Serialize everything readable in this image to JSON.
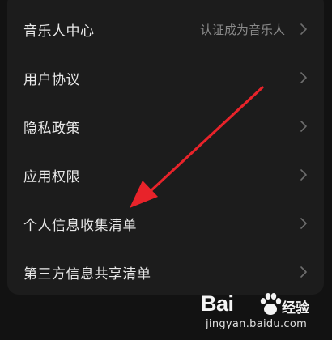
{
  "settings_list": {
    "items": [
      {
        "label": "音乐人中心",
        "value": "认证成为音乐人"
      },
      {
        "label": "用户协议",
        "value": ""
      },
      {
        "label": "隐私政策",
        "value": ""
      },
      {
        "label": "应用权限",
        "value": ""
      },
      {
        "label": "个人信息收集清单",
        "value": ""
      },
      {
        "label": "第三方信息共享清单",
        "value": ""
      }
    ]
  },
  "annotation": {
    "arrow_color": "#e8232a"
  },
  "watermark": {
    "logo_text": "Bai",
    "suffix": "经验",
    "url": "jingyan.baidu.com"
  },
  "colors": {
    "background": "#121212",
    "card": "#1c1c1c",
    "label": "#e8e8e8",
    "secondary": "#8a8a8a"
  }
}
